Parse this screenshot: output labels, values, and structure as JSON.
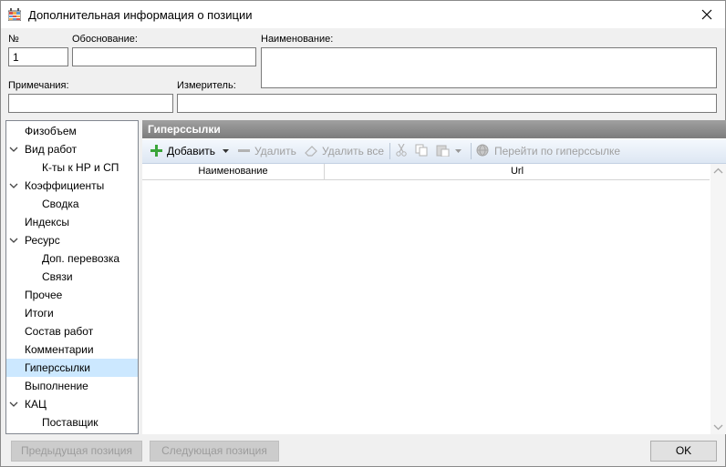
{
  "window": {
    "title": "Дополнительная информация о позиции"
  },
  "form": {
    "number_label": "№",
    "number_value": "1",
    "basis_label": "Обоснование:",
    "basis_value": "",
    "name_label": "Наименование:",
    "name_value": "",
    "notes_label": "Примечания:",
    "notes_value": "",
    "unit_label": "Измеритель:",
    "unit_value": ""
  },
  "tree": {
    "items": [
      {
        "label": "Физобъем",
        "level": 0,
        "expandable": false,
        "selected": false
      },
      {
        "label": "Вид работ",
        "level": 0,
        "expandable": true,
        "selected": false
      },
      {
        "label": "К-ты к НР и СП",
        "level": 1,
        "expandable": false,
        "selected": false
      },
      {
        "label": "Коэффициенты",
        "level": 0,
        "expandable": true,
        "selected": false
      },
      {
        "label": "Сводка",
        "level": 1,
        "expandable": false,
        "selected": false
      },
      {
        "label": "Индексы",
        "level": 0,
        "expandable": false,
        "selected": false
      },
      {
        "label": "Ресурс",
        "level": 0,
        "expandable": true,
        "selected": false
      },
      {
        "label": "Доп. перевозка",
        "level": 1,
        "expandable": false,
        "selected": false
      },
      {
        "label": "Связи",
        "level": 1,
        "expandable": false,
        "selected": false
      },
      {
        "label": "Прочее",
        "level": 0,
        "expandable": false,
        "selected": false
      },
      {
        "label": "Итоги",
        "level": 0,
        "expandable": false,
        "selected": false
      },
      {
        "label": "Состав работ",
        "level": 0,
        "expandable": false,
        "selected": false
      },
      {
        "label": "Комментарии",
        "level": 0,
        "expandable": false,
        "selected": false
      },
      {
        "label": "Гиперссылки",
        "level": 0,
        "expandable": false,
        "selected": true
      },
      {
        "label": "Выполнение",
        "level": 0,
        "expandable": false,
        "selected": false
      },
      {
        "label": "КАЦ",
        "level": 0,
        "expandable": true,
        "selected": false
      },
      {
        "label": "Поставщик",
        "level": 1,
        "expandable": false,
        "selected": false
      }
    ]
  },
  "panel": {
    "title": "Гиперссылки",
    "toolbar": {
      "add_label": "Добавить",
      "delete_label": "Удалить",
      "delete_all_label": "Удалить все",
      "goto_label": "Перейти по гиперссылке"
    },
    "columns": [
      "Наименование",
      "Url"
    ],
    "rows": []
  },
  "footer": {
    "prev_label": "Предыдущая позиция",
    "next_label": "Следующая позиция",
    "ok_label": "OK"
  },
  "colors": {
    "selection": "#cce8ff",
    "header_bar": "#888888",
    "add_icon": "#3aa53a"
  }
}
